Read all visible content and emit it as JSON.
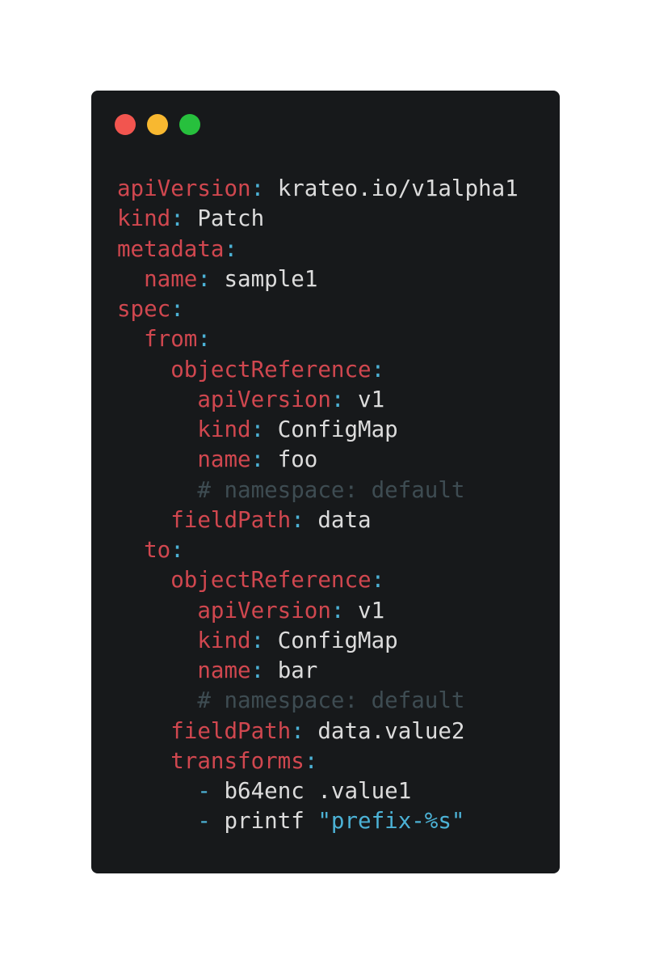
{
  "colors": {
    "background": "#ffffff",
    "window": "#17191b",
    "dot_close": "#f2554f",
    "dot_minimize": "#f8b830",
    "dot_maximize": "#27c03d",
    "key": "#d0474f",
    "punct": "#4cb2d6",
    "value": "#dcdcdc",
    "comment": "#3e4c52"
  },
  "code": {
    "lines": [
      {
        "indent": "",
        "key": "apiVersion",
        "sep": ":",
        "value": " krateo.io/v1alpha1"
      },
      {
        "indent": "",
        "key": "kind",
        "sep": ":",
        "value": " Patch"
      },
      {
        "indent": "",
        "key": "metadata",
        "sep": ":",
        "value": ""
      },
      {
        "indent": "  ",
        "key": "name",
        "sep": ":",
        "value": " sample1"
      },
      {
        "indent": "",
        "key": "spec",
        "sep": ":",
        "value": ""
      },
      {
        "indent": "  ",
        "key": "from",
        "sep": ":",
        "value": ""
      },
      {
        "indent": "    ",
        "key": "objectReference",
        "sep": ":",
        "value": ""
      },
      {
        "indent": "      ",
        "key": "apiVersion",
        "sep": ":",
        "value": " v1"
      },
      {
        "indent": "      ",
        "key": "kind",
        "sep": ":",
        "value": " ConfigMap"
      },
      {
        "indent": "      ",
        "key": "name",
        "sep": ":",
        "value": " foo"
      },
      {
        "indent": "      ",
        "comment": "# namespace: default"
      },
      {
        "indent": "    ",
        "key": "fieldPath",
        "sep": ":",
        "value": " data"
      },
      {
        "indent": "  ",
        "key": "to",
        "sep": ":",
        "value": ""
      },
      {
        "indent": "    ",
        "key": "objectReference",
        "sep": ":",
        "value": ""
      },
      {
        "indent": "      ",
        "key": "apiVersion",
        "sep": ":",
        "value": " v1"
      },
      {
        "indent": "      ",
        "key": "kind",
        "sep": ":",
        "value": " ConfigMap"
      },
      {
        "indent": "      ",
        "key": "name",
        "sep": ":",
        "value": " bar"
      },
      {
        "indent": "      ",
        "comment": "# namespace: default"
      },
      {
        "indent": "    ",
        "key": "fieldPath",
        "sep": ":",
        "value": " data.value2"
      },
      {
        "indent": "    ",
        "key": "transforms",
        "sep": ":",
        "value": ""
      },
      {
        "indent": "      ",
        "dash": "-",
        "value": " b64enc .value1"
      },
      {
        "indent": "      ",
        "dash": "-",
        "value": " printf ",
        "string": "\"prefix-%s\""
      }
    ]
  }
}
